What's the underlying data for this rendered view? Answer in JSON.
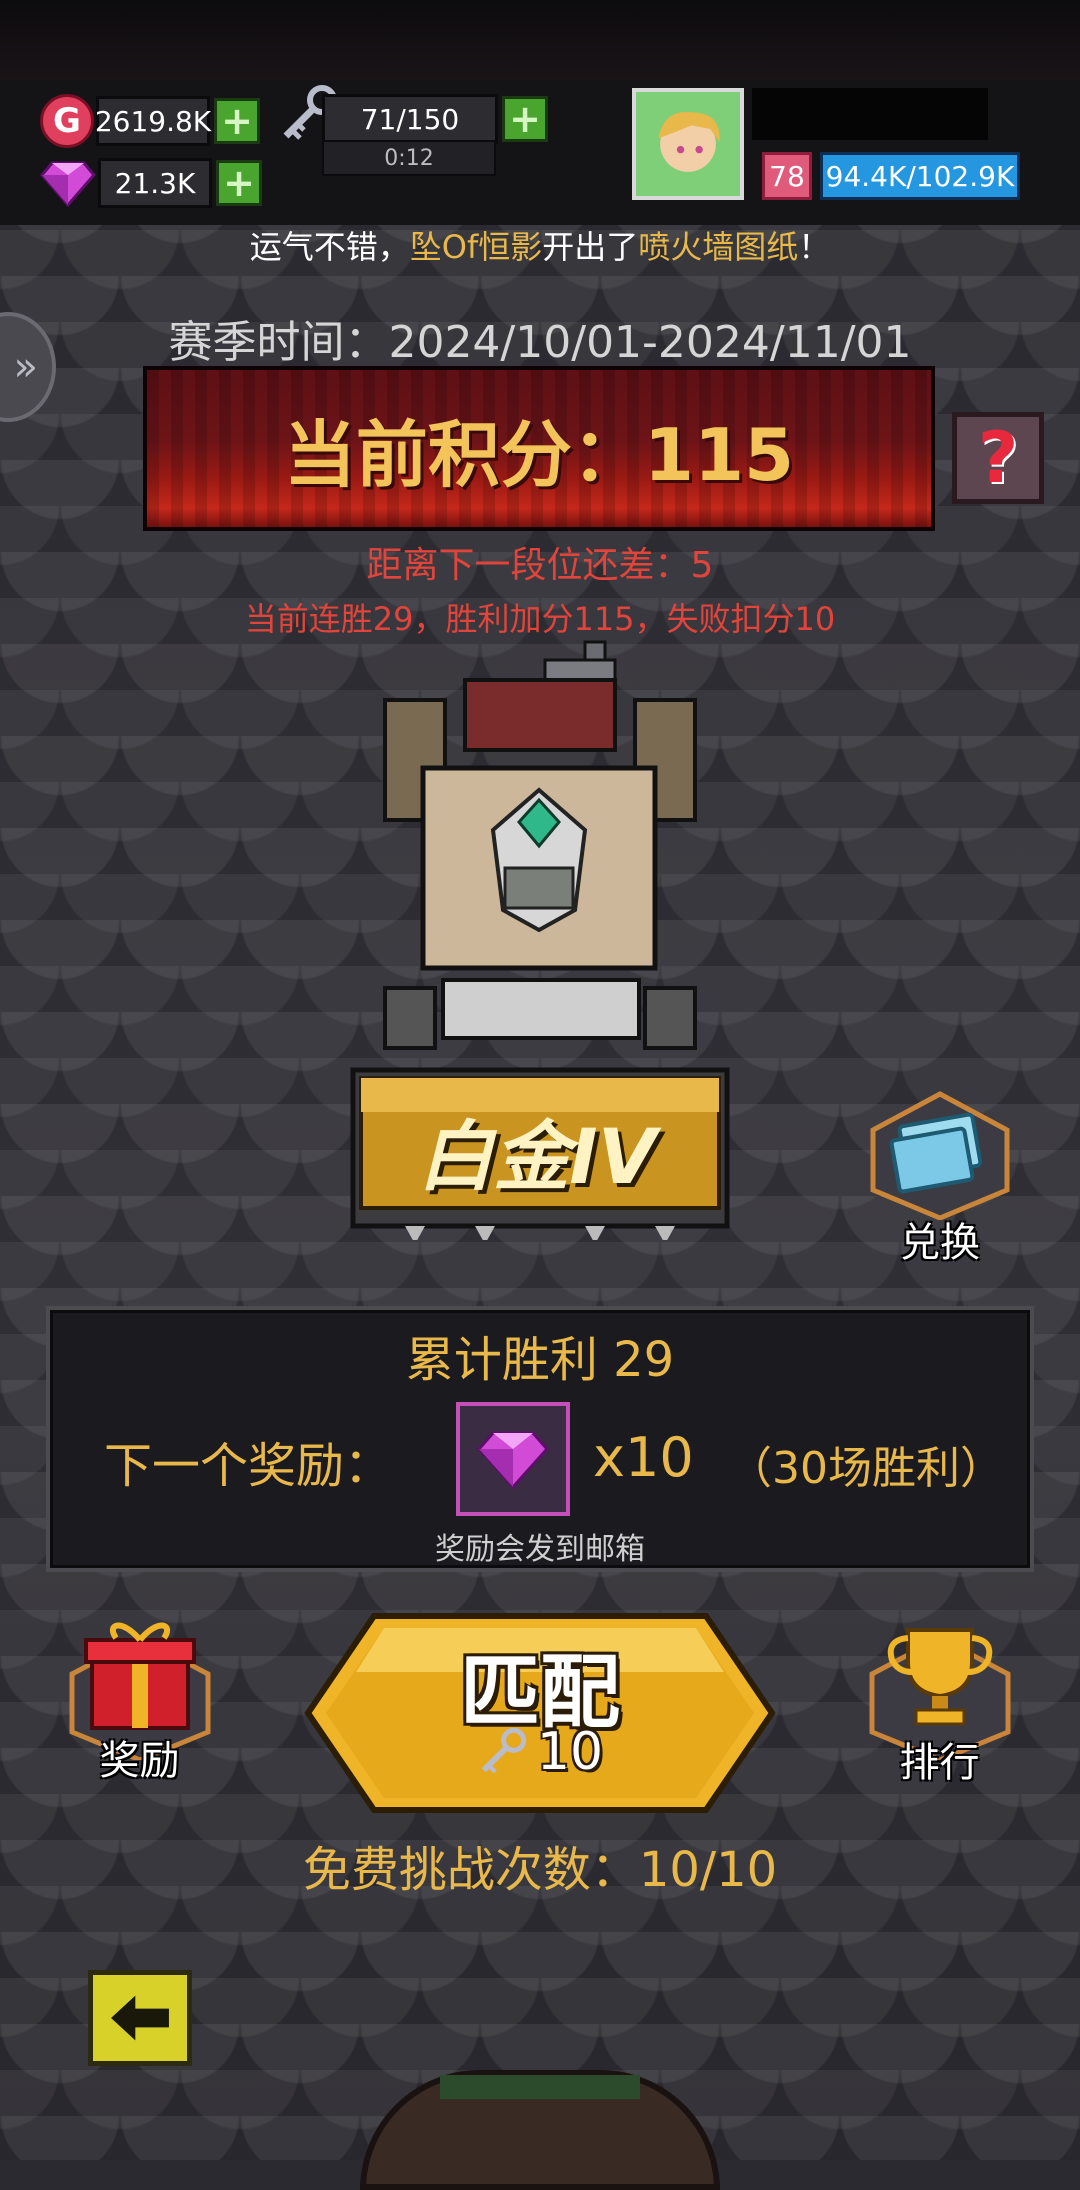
{
  "currency": {
    "gold": "2619.8K",
    "gems": "21.3K",
    "keys": "71/150",
    "key_timer": "0:12",
    "gold_icon_letter": "G"
  },
  "player": {
    "level": "78",
    "hp": "94.4K/102.9K"
  },
  "news": {
    "prefix": "运气不错，",
    "player_name": "坠Of恒影",
    "middle": "开出了",
    "item": "喷火墙图纸",
    "suffix": "！"
  },
  "season": {
    "time_text": "赛季时间：2024/10/01-2024/11/01"
  },
  "score": {
    "current": "当前积分：115",
    "help_symbol": "?",
    "gap_text": "距离下一段位还差：5",
    "streak_text": "当前连胜29，胜利加分115，失败扣分10"
  },
  "rank": {
    "name": "白金IV"
  },
  "exchange": {
    "label": "兑换"
  },
  "rewards": {
    "wins_text": "累计胜利 29",
    "next_label": "下一个奖励：",
    "quantity": "x10",
    "condition": "（30场胜利）",
    "mail_note": "奖励会发到邮箱"
  },
  "buttons": {
    "gift_label": "奖励",
    "rank_label": "排行",
    "match_title": "匹配",
    "match_cost": "10"
  },
  "free_challenges": "免费挑战次数：10/10",
  "colors": {
    "accent_gold": "#e8b84a",
    "warning_red": "#e0443a",
    "hp_blue": "#2497e0",
    "plus_green": "#4aa52f"
  }
}
